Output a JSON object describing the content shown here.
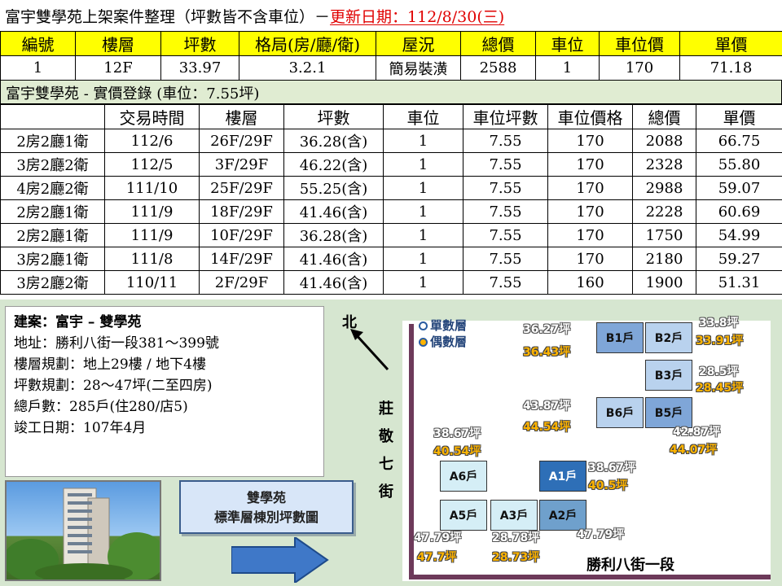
{
  "header": {
    "title": "富宇雙學苑上架案件整理（坪數皆不含車位）－",
    "update": "更新日期：112/8/30(三)"
  },
  "listing": {
    "columns": [
      "編號",
      "樓層",
      "坪數",
      "格局(房/廳/衛)",
      "屋況",
      "總價",
      "車位",
      "車位價",
      "單價"
    ],
    "row": [
      "1",
      "12F",
      "33.97",
      "3.2.1",
      "簡易裝潢",
      "2588",
      "1",
      "170",
      "71.18"
    ]
  },
  "transactions": {
    "title": "富宇雙學苑 - 實價登錄 (車位：7.55坪)",
    "columns": [
      "",
      "交易時間",
      "樓層",
      "坪數",
      "車位",
      "車位坪數",
      "車位價格",
      "總價",
      "單價"
    ],
    "rows": [
      [
        "2房2廳1衛",
        "112/6",
        "26F/29F",
        "36.28(含)",
        "1",
        "7.55",
        "170",
        "2088",
        "66.75"
      ],
      [
        "3房2廳2衛",
        "112/5",
        "3F/29F",
        "46.22(含)",
        "1",
        "7.55",
        "170",
        "2328",
        "55.80"
      ],
      [
        "4房2廳2衛",
        "111/10",
        "25F/29F",
        "55.25(含)",
        "1",
        "7.55",
        "170",
        "2988",
        "59.07"
      ],
      [
        "2房2廳1衛",
        "111/9",
        "18F/29F",
        "41.46(含)",
        "1",
        "7.55",
        "170",
        "2228",
        "60.69"
      ],
      [
        "2房2廳1衛",
        "111/9",
        "10F/29F",
        "36.28(含)",
        "1",
        "7.55",
        "170",
        "1750",
        "54.99"
      ],
      [
        "3房2廳1衛",
        "111/8",
        "14F/29F",
        "41.46(含)",
        "1",
        "7.55",
        "170",
        "2180",
        "59.27"
      ],
      [
        "3房2廳2衛",
        "110/11",
        "2F/29F",
        "41.46(含)",
        "1",
        "7.55",
        "160",
        "1900",
        "51.31"
      ]
    ]
  },
  "info": {
    "name": "建案：富宇 – 雙學苑",
    "address": "地址：勝利八街一段381～399號",
    "floors": "樓層規劃：地上29樓 / 地下4樓",
    "size": "坪數規劃：28～47坪(二至四房)",
    "households": "總戶數：285戶(住280/店5)",
    "completion": "竣工日期：107年4月"
  },
  "caption": {
    "line1": "雙學苑",
    "line2": "標準層棟別坪數圖"
  },
  "map": {
    "north": "北",
    "street_vertical": [
      "莊",
      "敬",
      "七",
      "街"
    ],
    "street_horizontal": "勝利八街一段",
    "legend_odd": "單數層",
    "legend_even": "偶數層",
    "units": {
      "b1": "B1戶",
      "b2": "B2戶",
      "b3": "B3戶",
      "b5": "B5戶",
      "b6": "B6戶",
      "a1": "A1戶",
      "a2": "A2戶",
      "a3": "A3戶",
      "a5": "A5戶",
      "a6": "A6戶"
    },
    "sizes": {
      "b1_odd": "36.27坪",
      "b1_even": "36.43坪",
      "b2_odd": "33.8坪",
      "b2_even": "33.91坪",
      "b3_odd": "28.5坪",
      "b3_even": "28.45坪",
      "b6_odd": "43.87坪",
      "b6_even": "44.54坪",
      "b5_odd": "42.87坪",
      "b5_even": "44.07坪",
      "a6_odd": "38.67坪",
      "a6_even": "40.54坪",
      "a1_odd": "38.67坪",
      "a1_even": "40.5坪",
      "a5_odd": "47.79坪",
      "a5_even": "47.7坪",
      "a3_odd": "28.78坪",
      "a3_even": "28.73坪",
      "a2_odd": "47.79坪"
    }
  }
}
